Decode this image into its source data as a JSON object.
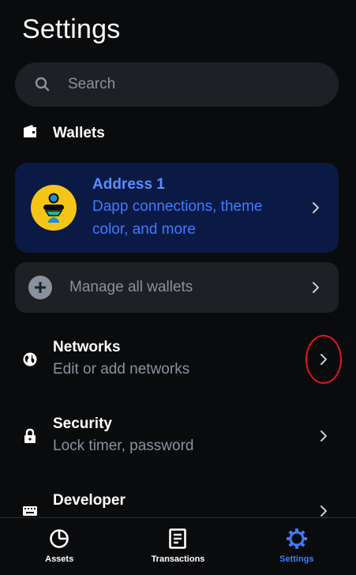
{
  "header": {
    "title": "Settings"
  },
  "search": {
    "placeholder": "Search"
  },
  "wallets_section": {
    "label": "Wallets"
  },
  "address_card": {
    "title": "Address 1",
    "subtitle": "Dapp connections, theme color, and more"
  },
  "manage_wallets": {
    "label": "Manage all wallets"
  },
  "settings_rows": [
    {
      "title": "Networks",
      "subtitle": "Edit or add networks",
      "icon": "globe-icon"
    },
    {
      "title": "Security",
      "subtitle": "Lock timer, password",
      "icon": "lock-icon"
    },
    {
      "title": "Developer",
      "subtitle": "",
      "icon": "keyboard-icon"
    }
  ],
  "tabs": [
    {
      "label": "Assets",
      "icon": "pie-chart-icon",
      "active": false
    },
    {
      "label": "Transactions",
      "icon": "document-icon",
      "active": false
    },
    {
      "label": "Settings",
      "icon": "gear-icon",
      "active": true
    }
  ],
  "colors": {
    "background": "#0a0b0d",
    "surface": "#1e2025",
    "accent_blue": "#3d7bff",
    "address_card_bg": "#0b1a45",
    "highlight_red": "#e0141e"
  }
}
